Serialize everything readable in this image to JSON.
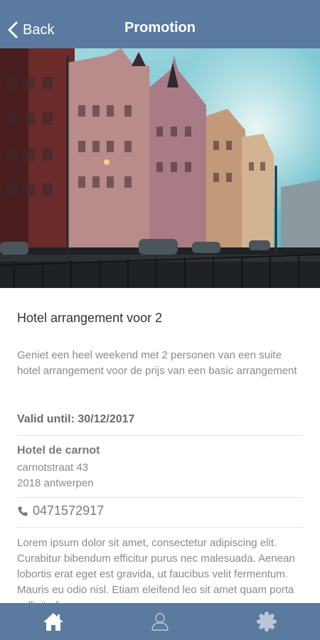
{
  "header": {
    "back_label": "Back",
    "title": "Promotion"
  },
  "hero": {
    "image": "city-street-buildings-photo"
  },
  "promotion": {
    "title": "Hotel arrangement voor 2",
    "description": "Geniet een heel weekend met 2 personen van een suite hotel arrangement voor de prijs van een basic arrangement",
    "valid_label": "Valid until: 30/12/2017",
    "hotel_name": "Hotel de carnot",
    "address_line1": "carnotstraat 43",
    "address_line2": "2018 antwerpen",
    "phone": "0471572917",
    "body": "Lorem ipsum dolor sit amet, consectetur adipiscing elit. Curabitur bibendum efficitur purus nec malesuada. Aenean lobortis erat eget est gravida, ut faucibus velit fermentum. Mauris eu odio nisl. Etiam eleifend leo sit amet quam porta sollicitudin."
  },
  "tabbar": {
    "tabs": [
      {
        "icon": "home-icon"
      },
      {
        "icon": "user-icon"
      },
      {
        "icon": "badge-icon"
      }
    ]
  },
  "colors": {
    "header_bg": "#5a7aa0",
    "tabbar_bg": "#5a7aa0",
    "text_muted": "#8a8a8a"
  }
}
